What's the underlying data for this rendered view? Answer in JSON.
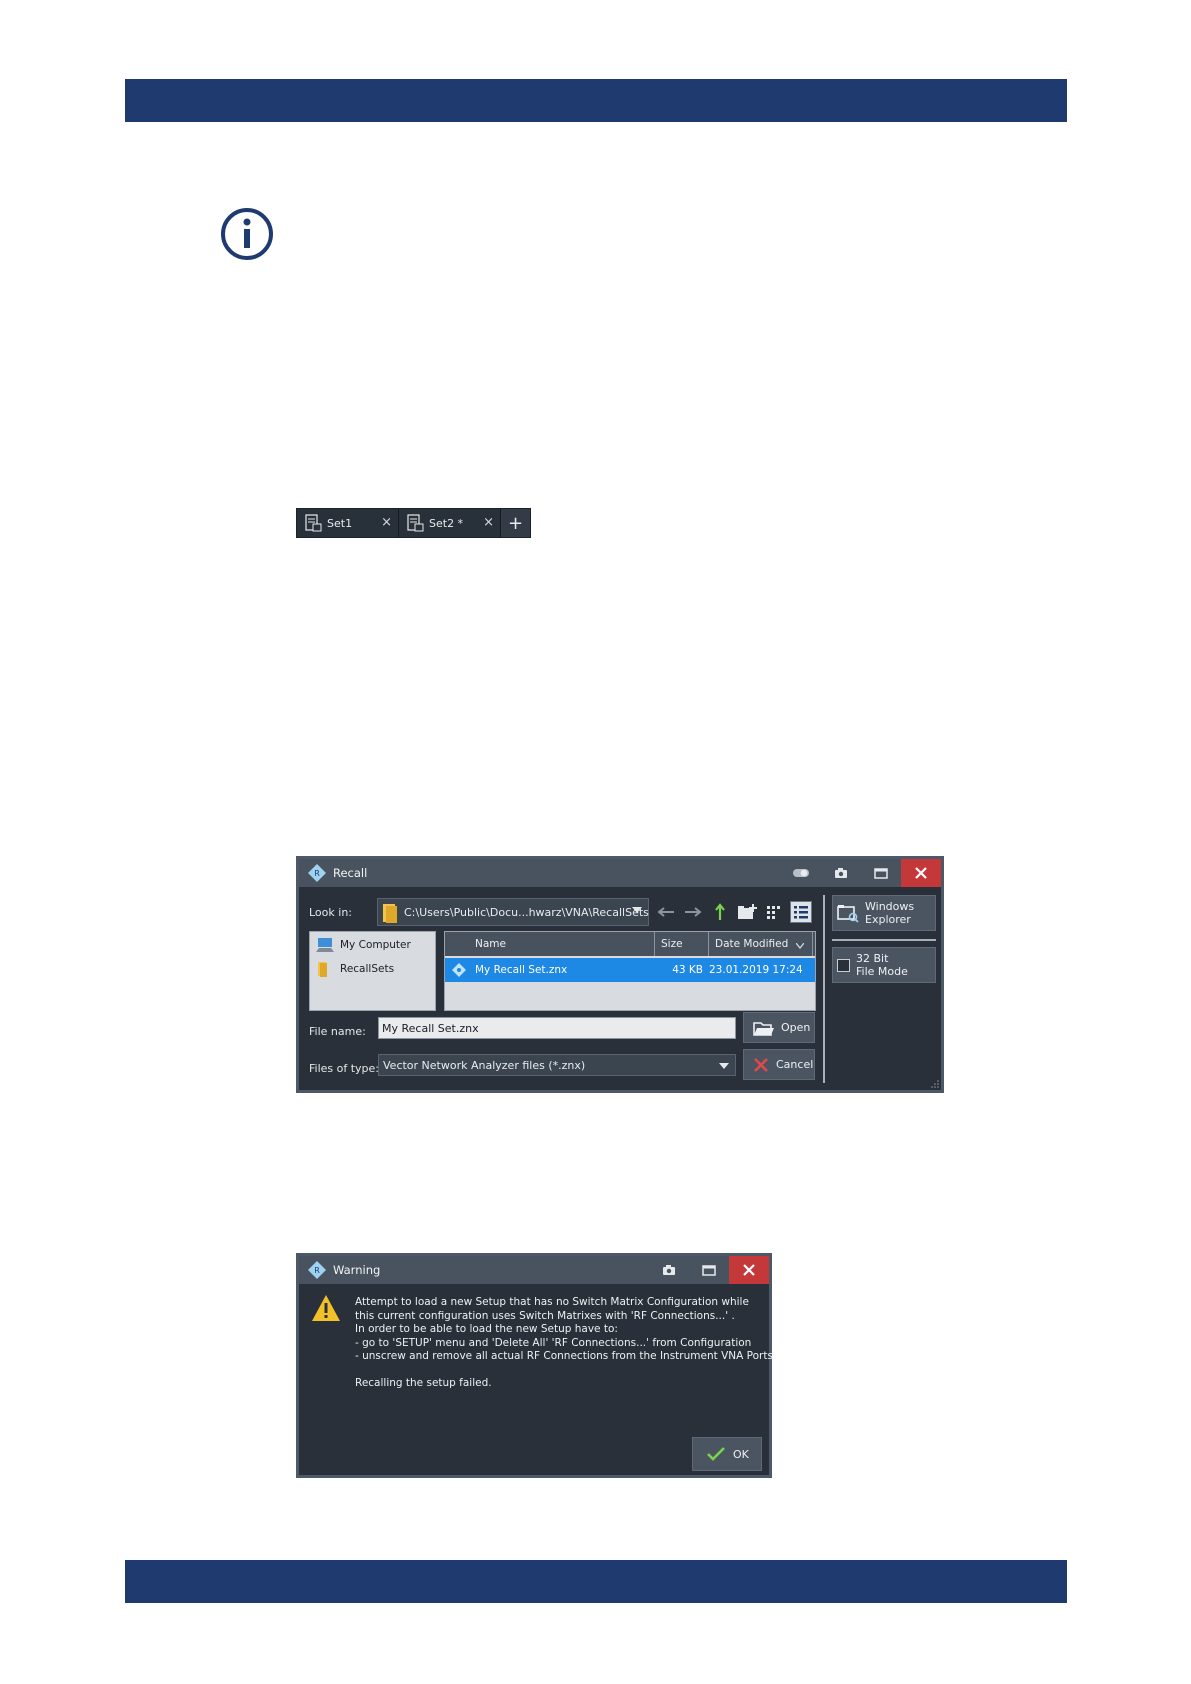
{
  "tabs": {
    "items": [
      {
        "label": "Set1",
        "close": "×"
      },
      {
        "label": "Set2 *",
        "close": "×"
      }
    ],
    "add": "+"
  },
  "recall": {
    "title": "Recall",
    "look_in_label": "Look in:",
    "look_in_value": "C:\\Users\\Public\\Docu...hwarz\\VNA\\RecallSets",
    "places": [
      "My Computer",
      "RecallSets"
    ],
    "columns": [
      "Name",
      "Size",
      "Date Modified"
    ],
    "files": [
      {
        "name": "My Recall Set.znx",
        "size": "43 KB",
        "modified": "23.01.2019 17:24"
      }
    ],
    "file_name_label": "File name:",
    "file_name_value": "My Recall Set.znx",
    "files_of_type_label": "Files of type:",
    "files_of_type_value": "Vector Network Analyzer files (*.znx)",
    "open_label": "Open",
    "cancel_label": "Cancel",
    "windows_explorer_line1": "Windows",
    "windows_explorer_line2": "Explorer",
    "bit_mode_line1": "32 Bit",
    "bit_mode_line2": "File Mode"
  },
  "warning": {
    "title": "Warning",
    "lines": [
      "Attempt to load a new Setup that has no Switch Matrix Configuration while",
      "this current configuration uses Switch Matrixes with 'RF Connections...' .",
      "In order to be able to load the new Setup have to:",
      "- go to 'SETUP' menu and 'Delete All' 'RF Connections...' from Configuration",
      "- unscrew and remove all actual RF Connections from the Instrument VNA Ports.",
      "",
      "Recalling the setup failed."
    ],
    "ok_label": "OK"
  },
  "colors": {
    "band": "#1e3a6e",
    "dialog_bg": "#2a3039",
    "titlebar": "#49535f",
    "close_red": "#c4383a",
    "selection": "#1e88e5"
  }
}
